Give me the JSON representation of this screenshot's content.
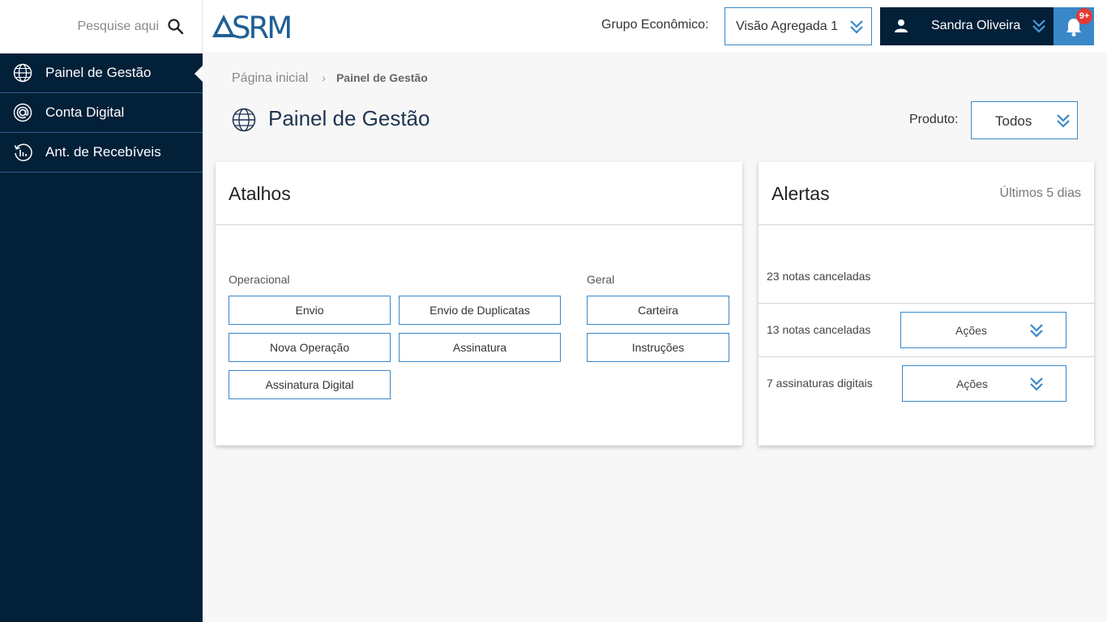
{
  "search": {
    "placeholder": "Pesquise aqui"
  },
  "brand": {
    "logo_text": "SRM",
    "accent": "#3a87c8",
    "dark": "#032039"
  },
  "header": {
    "grupo_label": "Grupo Econômico:",
    "grupo_value": "Visão Agregada 1",
    "user_name": "Sandra Oliveira",
    "notif_badge": "9+"
  },
  "sidebar": {
    "items": [
      {
        "label": "Painel de Gestão",
        "icon": "globe-icon",
        "active": true
      },
      {
        "label": "Conta Digital",
        "icon": "at-icon",
        "active": false
      },
      {
        "label": "Ant. de Recebíveis",
        "icon": "history-chart-icon",
        "active": false
      }
    ]
  },
  "breadcrumb": {
    "home": "Página inicial",
    "separator": "›",
    "current": "Painel de Gestão"
  },
  "page": {
    "title": "Painel de Gestão",
    "produto_label": "Produto:",
    "produto_value": "Todos"
  },
  "atalhos": {
    "title": "Atalhos",
    "operacional_label": "Operacional",
    "geral_label": "Geral",
    "operacional": [
      "Envio",
      "Envio de Duplicatas",
      "Nova Operação",
      "Assinatura",
      "Assinatura Digital"
    ],
    "geral": [
      "Carteira",
      "Instruções"
    ]
  },
  "alertas": {
    "title": "Alertas",
    "period": "Últimos 5 dias",
    "items": [
      {
        "text": "23 notas canceladas"
      },
      {
        "text": "13 notas canceladas",
        "action": "Ações"
      },
      {
        "text": "7 assinaturas digitais",
        "action": "Ações"
      }
    ]
  }
}
